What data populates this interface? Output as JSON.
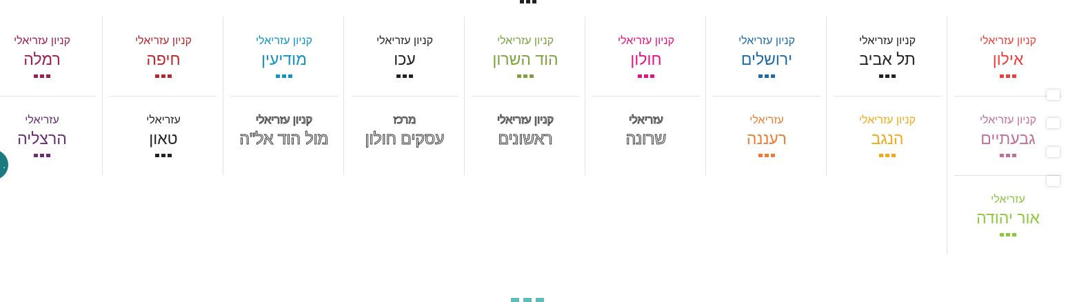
{
  "colors": {
    "divider": "#e2e2e2",
    "pagination_accent": "#5cbdb9",
    "chat_button": "#1b7a80"
  },
  "icons": {
    "top_more": "ellipsis-dots-icon",
    "pagination": "pagination-dots-icon",
    "chat": "chat-bubble-icon",
    "side": "side-handle-icon"
  },
  "chat_button": {
    "label": "."
  },
  "columns": [
    {
      "cells": [
        {
          "sub": "קניון עזריאלי",
          "name": "אילון",
          "color": "#e8413b",
          "dots_color": "#e8413b",
          "outline": false
        },
        {
          "sub": "קניון עזריאלי",
          "name": "גבעתיים",
          "color": "#c26f9c",
          "dots_color": "#c26f9c",
          "outline": false
        },
        {
          "sub": "עזריאלי",
          "name": "אור יהודה",
          "color": "#8dc63f",
          "dots_color": "#8dc63f",
          "outline": false
        }
      ]
    },
    {
      "cells": [
        {
          "sub": "קניון עזריאלי",
          "name": "תל אביב",
          "color": "#222222",
          "dots_color": "#222222",
          "outline": false
        },
        {
          "sub": "קניון עזריאלי",
          "name": "הנגב",
          "color": "#f2a818",
          "dots_color": "#f2a818",
          "outline": false
        }
      ]
    },
    {
      "cells": [
        {
          "sub": "קניון עזריאלי",
          "name": "ירושלים",
          "color": "#1f6aa6",
          "dots_color": "#1f6aa6",
          "outline": false
        },
        {
          "sub": "עזריאלי",
          "name": "רעננה",
          "color": "#ef7b32",
          "dots_color": "#ef7b32",
          "outline": false
        }
      ]
    },
    {
      "cells": [
        {
          "sub": "קניון עזריאלי",
          "name": "חולון",
          "color": "#e3127f",
          "dots_color": "#e3127f",
          "outline": false
        },
        {
          "sub": "עזריאלי",
          "name": "שרונה",
          "color": "#333333",
          "dots_color": "",
          "outline": true
        }
      ]
    },
    {
      "cells": [
        {
          "sub": "קניון עזריאלי",
          "name": "הוד השרון",
          "color": "#7ba23f",
          "dots_color": "#7ba23f",
          "outline": false
        },
        {
          "sub": "קניון עזריאלי",
          "name": "ראשונים",
          "color": "#333333",
          "dots_color": "",
          "outline": true
        }
      ]
    },
    {
      "cells": [
        {
          "sub": "קניון עזריאלי",
          "name": "עכו",
          "color": "#222222",
          "dots_color": "#222222",
          "outline": false
        },
        {
          "sub": "מרכז",
          "name": "עסקים חולון",
          "color": "#333333",
          "dots_color": "",
          "outline": true
        }
      ]
    },
    {
      "cells": [
        {
          "sub": "קניון עזריאלי",
          "name": "מודיעין",
          "color": "#1393c4",
          "dots_color": "#1393c4",
          "outline": false
        },
        {
          "sub": "קניון עזריאלי",
          "name": "מול הוד אל\"ה",
          "color": "#333333",
          "dots_color": "",
          "outline": true
        }
      ]
    },
    {
      "cells": [
        {
          "sub": "קניון עזריאלי",
          "name": "חיפה",
          "color": "#b8272d",
          "dots_color": "#b8272d",
          "outline": false
        },
        {
          "sub": "עזריאלי",
          "name": "טאון",
          "color": "#222222",
          "dots_color": "#222222",
          "outline": false
        }
      ]
    },
    {
      "cells": [
        {
          "sub": "קניון עזריאלי",
          "name": "רמלה",
          "color": "#9c1f4f",
          "dots_color": "#9c1f4f",
          "outline": false
        },
        {
          "sub": "עזריאלי",
          "name": "הרצליה",
          "color": "#6a2c73",
          "dots_color": "#6a2c73",
          "outline": false
        }
      ]
    }
  ]
}
